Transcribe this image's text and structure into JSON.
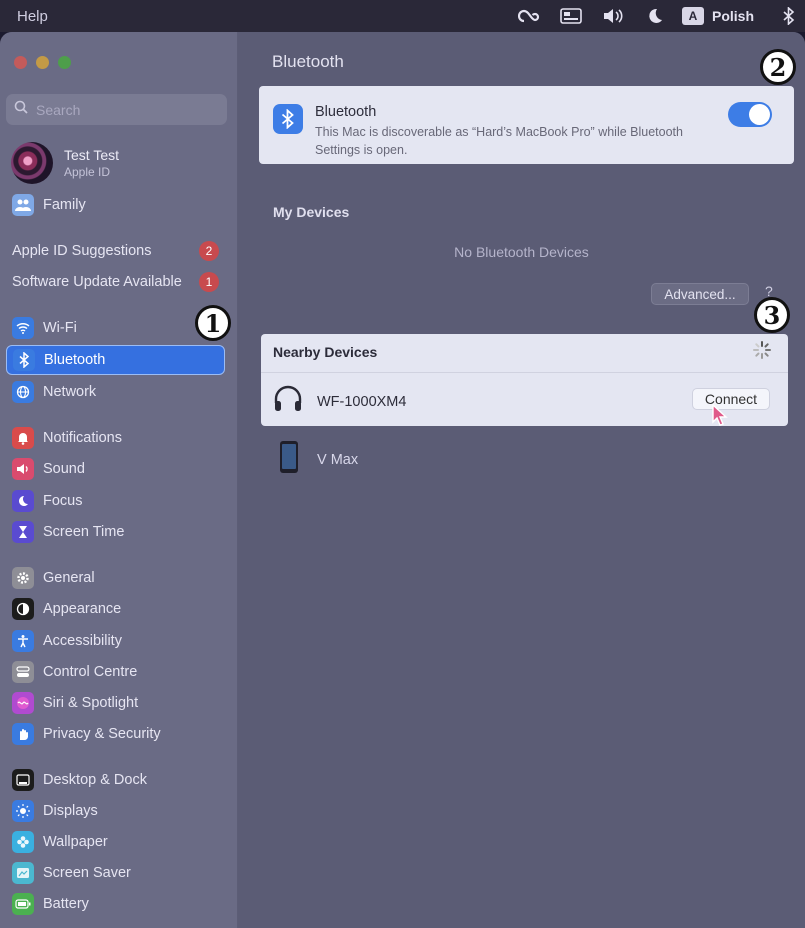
{
  "menubar": {
    "help_label": "Help",
    "input_language": "Polish",
    "input_letter": "A",
    "icons": [
      "creative-cloud-icon",
      "keyboard-display-icon",
      "volume-icon",
      "moon-icon",
      "bluetooth-icon"
    ]
  },
  "sidebar": {
    "search_placeholder": "Search",
    "profile": {
      "name": "Test Test",
      "subtitle": "Apple ID"
    },
    "family_label": "Family",
    "suggestions": [
      {
        "label": "Apple ID Suggestions",
        "badge": "2"
      },
      {
        "label": "Software Update Available",
        "badge": "1"
      }
    ],
    "items": [
      {
        "label": "Wi-Fi",
        "icon": "wifi-icon",
        "color": "#3a7be0"
      },
      {
        "label": "Bluetooth",
        "icon": "bluetooth-icon",
        "color": "#3a7be0",
        "selected": true
      },
      {
        "label": "Network",
        "icon": "globe-icon",
        "color": "#3a7be0"
      },
      {
        "label": "Notifications",
        "icon": "bell-icon",
        "color": "#d94b4b"
      },
      {
        "label": "Sound",
        "icon": "speaker-icon",
        "color": "#d94b6e"
      },
      {
        "label": "Focus",
        "icon": "moon-icon",
        "color": "#5a4bd0"
      },
      {
        "label": "Screen Time",
        "icon": "hourglass-icon",
        "color": "#5a4bd0"
      },
      {
        "label": "General",
        "icon": "gear-icon",
        "color": "#8e8e96"
      },
      {
        "label": "Appearance",
        "icon": "appearance-icon",
        "color": "#1c1c1c"
      },
      {
        "label": "Accessibility",
        "icon": "accessibility-icon",
        "color": "#3a7be0"
      },
      {
        "label": "Control Centre",
        "icon": "control-centre-icon",
        "color": "#8e8e96"
      },
      {
        "label": "Siri & Spotlight",
        "icon": "siri-icon",
        "color": "#b04bd0"
      },
      {
        "label": "Privacy & Security",
        "icon": "hand-icon",
        "color": "#3a7be0"
      },
      {
        "label": "Desktop & Dock",
        "icon": "dock-icon",
        "color": "#1c1c1c"
      },
      {
        "label": "Displays",
        "icon": "sun-icon",
        "color": "#3a7be0"
      },
      {
        "label": "Wallpaper",
        "icon": "flower-icon",
        "color": "#3ab0e0"
      },
      {
        "label": "Screen Saver",
        "icon": "screensaver-icon",
        "color": "#4bb8d0"
      },
      {
        "label": "Battery",
        "icon": "battery-icon",
        "color": "#4bb050"
      }
    ]
  },
  "annotations": {
    "one": "1",
    "two": "2",
    "three": "3"
  },
  "main": {
    "title": "Bluetooth",
    "bluetooth_card": {
      "title": "Bluetooth",
      "description": "This Mac is discoverable as “Hard’s MacBook Pro” while Bluetooth Settings is open.",
      "enabled": true
    },
    "my_devices_label": "My Devices",
    "no_devices_text": "No Bluetooth Devices",
    "advanced_label": "Advanced...",
    "help_label": "?",
    "nearby_label": "Nearby Devices",
    "nearby_devices": [
      {
        "name": "WF-1000XM4",
        "icon": "headphones-icon",
        "action": "Connect"
      },
      {
        "name": "V Max",
        "icon": "phone-icon"
      }
    ]
  }
}
